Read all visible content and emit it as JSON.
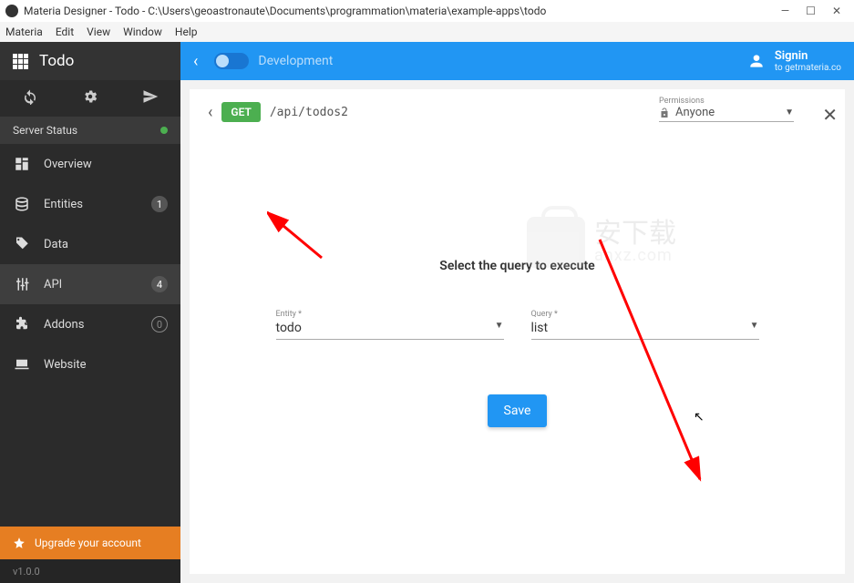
{
  "window": {
    "title": "Materia Designer - Todo - C:\\Users\\geoastronaute\\Documents\\programmation\\materia\\example-apps\\todo"
  },
  "menu": {
    "items": [
      "Materia",
      "Edit",
      "View",
      "Window",
      "Help"
    ]
  },
  "sidebar": {
    "title": "Todo",
    "server_status": "Server Status",
    "items": [
      {
        "label": "Overview",
        "badge": ""
      },
      {
        "label": "Entities",
        "badge": "1"
      },
      {
        "label": "Data",
        "badge": ""
      },
      {
        "label": "API",
        "badge": "4"
      },
      {
        "label": "Addons",
        "badge": "0"
      },
      {
        "label": "Website",
        "badge": ""
      }
    ],
    "upgrade": "Upgrade your account",
    "version": "v1.0.0"
  },
  "topbar": {
    "env": "Development",
    "signin": "Signin",
    "signin_sub": "to getmateria.co"
  },
  "endpoint": {
    "method": "GET",
    "path": "/api/todos2",
    "permissions_label": "Permissions",
    "permissions_value": "Anyone"
  },
  "form": {
    "title": "Select the query to execute",
    "entity_label": "Entity *",
    "entity_value": "todo",
    "query_label": "Query *",
    "query_value": "list",
    "save": "Save"
  },
  "watermark": {
    "top": "安下载",
    "bottom": "anxz.com"
  }
}
